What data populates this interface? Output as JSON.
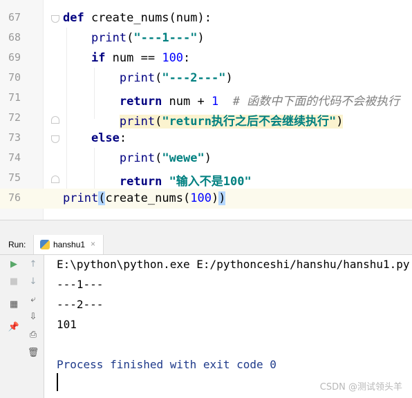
{
  "editor": {
    "lines": [
      {
        "num": "67",
        "tokens": [
          {
            "t": "def",
            "c": "kw"
          },
          {
            "t": " create_nums(num):",
            "c": "plain"
          }
        ]
      },
      {
        "num": "68",
        "tokens": [
          {
            "t": "    "
          },
          {
            "t": "print",
            "c": "bi"
          },
          {
            "t": "(",
            "c": "plain"
          },
          {
            "t": "\"---1---\"",
            "c": "str"
          },
          {
            "t": ")",
            "c": "plain"
          }
        ]
      },
      {
        "num": "69",
        "tokens": [
          {
            "t": "    "
          },
          {
            "t": "if",
            "c": "kw"
          },
          {
            "t": " num == ",
            "c": "plain"
          },
          {
            "t": "100",
            "c": "num"
          },
          {
            "t": ":",
            "c": "plain"
          }
        ]
      },
      {
        "num": "70",
        "tokens": [
          {
            "t": "        "
          },
          {
            "t": "print",
            "c": "bi"
          },
          {
            "t": "(",
            "c": "plain"
          },
          {
            "t": "\"---2---\"",
            "c": "str"
          },
          {
            "t": ")",
            "c": "plain"
          }
        ]
      },
      {
        "num": "71",
        "tokens": [
          {
            "t": "        "
          },
          {
            "t": "return",
            "c": "kw"
          },
          {
            "t": " num + ",
            "c": "plain"
          },
          {
            "t": "1",
            "c": "num"
          },
          {
            "t": "  ",
            "c": "plain"
          },
          {
            "t": "# 函数中下面的代码不会被执行",
            "c": "cmt"
          }
        ]
      },
      {
        "num": "72",
        "tokens": [
          {
            "t": "        "
          },
          {
            "t": "print",
            "c": "bi hl"
          },
          {
            "t": "(",
            "c": "plain hl"
          },
          {
            "t": "\"return执行之后不会继续执行\"",
            "c": "str hl"
          },
          {
            "t": ")",
            "c": "plain hl"
          }
        ]
      },
      {
        "num": "73",
        "tokens": [
          {
            "t": "    "
          },
          {
            "t": "else",
            "c": "kw"
          },
          {
            "t": ":",
            "c": "plain"
          }
        ]
      },
      {
        "num": "74",
        "tokens": [
          {
            "t": "        "
          },
          {
            "t": "print",
            "c": "bi"
          },
          {
            "t": "(",
            "c": "plain"
          },
          {
            "t": "\"wewe\"",
            "c": "str"
          },
          {
            "t": ")",
            "c": "plain"
          }
        ]
      },
      {
        "num": "75",
        "tokens": [
          {
            "t": "        "
          },
          {
            "t": "return",
            "c": "kw"
          },
          {
            "t": " ",
            "c": "plain"
          },
          {
            "t": "\"输入不是100\"",
            "c": "str"
          }
        ]
      },
      {
        "num": "76",
        "tokens": [
          {
            "t": "print",
            "c": "bi"
          },
          {
            "t": "(",
            "c": "plain br"
          },
          {
            "t": "create_nums(",
            "c": "plain"
          },
          {
            "t": "100",
            "c": "num"
          },
          {
            "t": ")",
            "c": "plain"
          },
          {
            "t": ")",
            "c": "plain br"
          }
        ]
      }
    ]
  },
  "run_panel": {
    "label": "Run:",
    "tab_title": "hanshu1",
    "tab_close": "×"
  },
  "console": {
    "lines": [
      "E:\\python\\python.exe E:/pythonceshi/hanshu/hanshu1.py",
      "---1---",
      "---2---",
      "101",
      "",
      "Process finished with exit code 0"
    ]
  },
  "tools": [
    {
      "name": "run-icon",
      "glyph": "▶",
      "color": "#59a869"
    },
    {
      "name": "up-arrow-icon",
      "glyph": "↑",
      "color": "#9aa7b0"
    },
    {
      "name": "stop-icon",
      "glyph": "■",
      "color": "#c9c9c9"
    },
    {
      "name": "down-arrow-icon",
      "glyph": "↓",
      "color": "#9aa7b0"
    },
    {
      "name": "layout-icon",
      "glyph": "▦",
      "color": "#555555"
    },
    {
      "name": "soft-wrap-icon",
      "glyph": "⤶",
      "color": "#555555"
    },
    {
      "name": "scroll-to-end-icon",
      "glyph": "⇩",
      "color": "#555555"
    },
    {
      "name": "pin-icon",
      "glyph": "📌",
      "color": "#555555"
    },
    {
      "name": "print-icon",
      "glyph": "⎙",
      "color": "#555555"
    },
    {
      "name": "trash-icon",
      "glyph": "🗑",
      "color": "#555555"
    }
  ],
  "watermark": "CSDN @测试领头羊",
  "colors": {
    "keyword": "#000080",
    "string": "#008080",
    "number": "#0000ff",
    "comment": "#808080",
    "current_line": "#fcfaed"
  }
}
